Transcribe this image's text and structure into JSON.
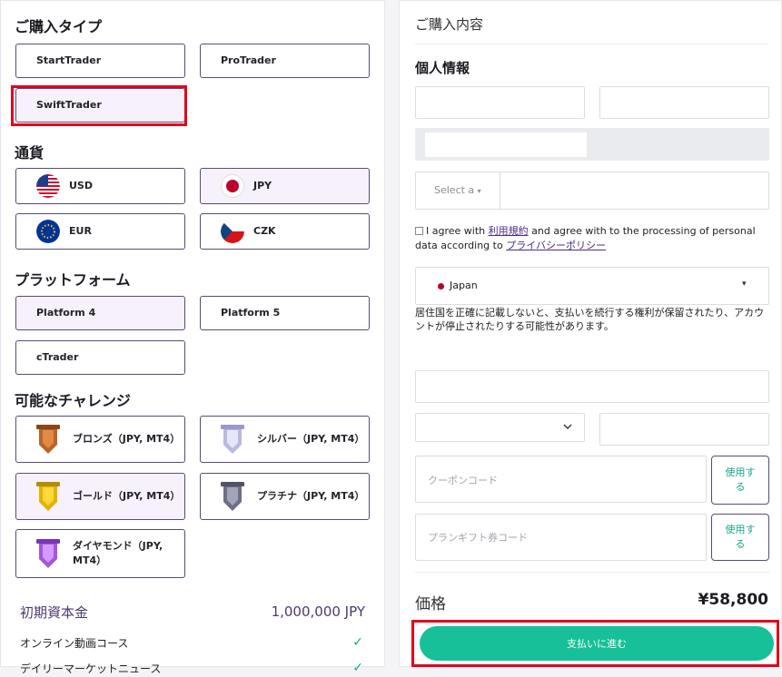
{
  "left": {
    "purchase_type": {
      "title": "ご購入タイプ",
      "options": [
        "StartTrader",
        "ProTrader",
        "SwiftTrader"
      ]
    },
    "currency": {
      "title": "通貨",
      "options": [
        "USD",
        "JPY",
        "EUR",
        "CZK"
      ]
    },
    "platform": {
      "title": "プラットフォーム",
      "options": [
        "Platform 4",
        "Platform 5",
        "cTrader"
      ]
    },
    "challenge": {
      "title": "可能なチャレンジ",
      "options": [
        "ブロンズ（JPY, MT4）",
        "シルバー（JPY, MT4）",
        "ゴールド（JPY, MT4）",
        "プラチナ（JPY, MT4）",
        "ダイヤモンド（JPY, MT4）"
      ]
    },
    "initial_capital": {
      "label": "初期資本金",
      "value": "1,000,000 JPY"
    },
    "features": [
      {
        "label": "オンライン動画コース"
      },
      {
        "label": "デイリーマーケットニュース"
      }
    ]
  },
  "right": {
    "title": "ご購入内容",
    "personal_info": "個人情報",
    "select_placeholder": "Select a",
    "agree": {
      "pre": "I agree with ",
      "terms": "利用規約",
      "mid": " and agree with to the processing of personal data according to ",
      "privacy": "プライバシーポリシー"
    },
    "country": "Japan",
    "notice": "居住国を正確に記載しないと、支払いを続行する権利が保留されたり、アカウントが停止されたりする可能性があります。",
    "coupon_placeholder": "クーポンコード",
    "gift_placeholder": "プランギフト券コード",
    "use_label": "使用する",
    "price_label": "価格",
    "price_value": "¥58,800",
    "pay_label": "支払いに進む"
  },
  "colors": {
    "accent_purple": "#5a4a78",
    "selected_bg": "#f7f1fb",
    "pay_green": "#17c098",
    "highlight_red": "#e3001b",
    "check_green": "#17a789"
  }
}
